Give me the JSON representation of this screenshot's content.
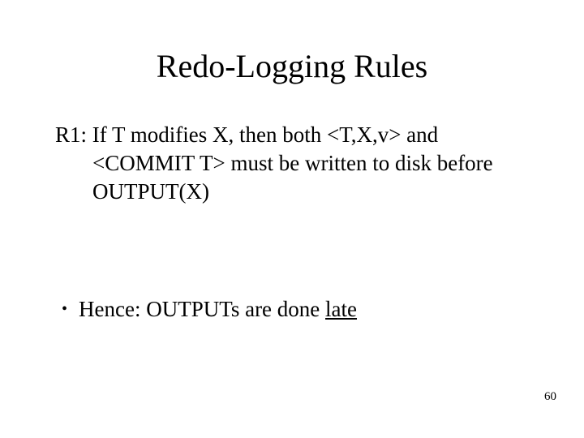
{
  "title": "Redo-Logging Rules",
  "rule1": "R1: If T modifies X, then both <T,X,v> and <COMMIT T> must be written to disk before OUTPUT(X)",
  "bullet_prefix": "Hence: OUTPUTs are done ",
  "bullet_suffix": "late",
  "page_number": "60"
}
